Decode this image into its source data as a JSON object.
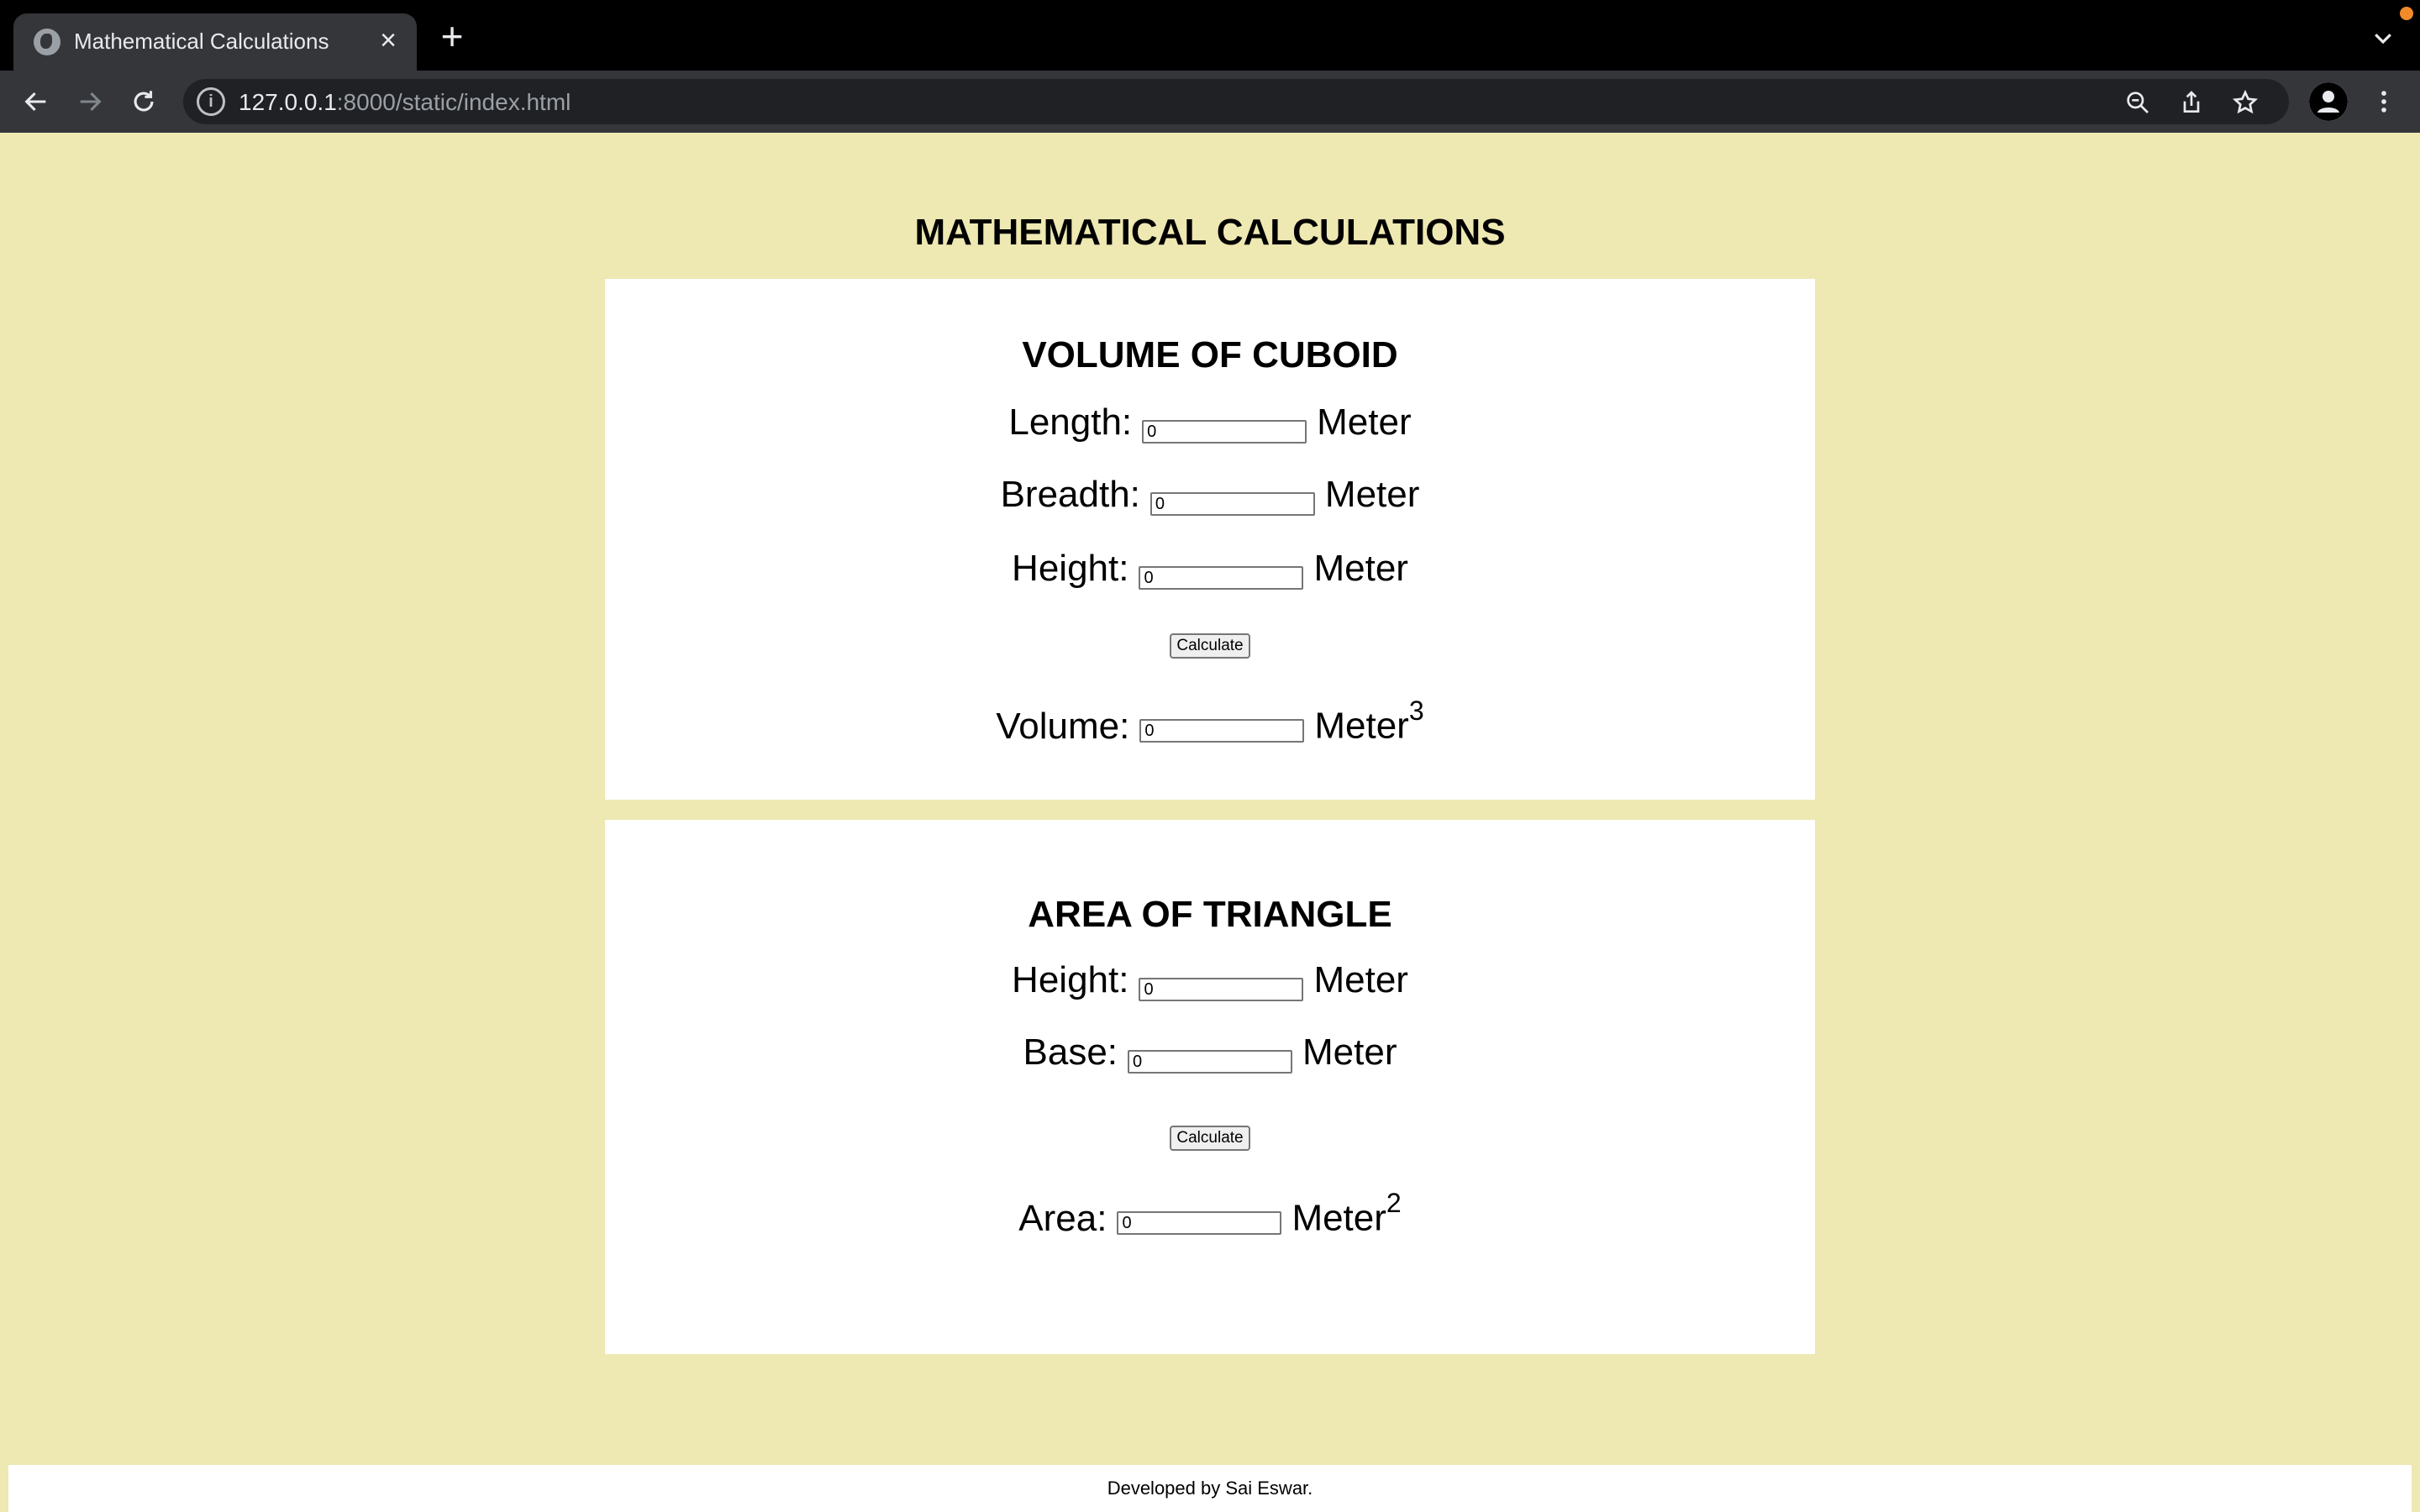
{
  "browser": {
    "tab_title": "Mathematical Calculations",
    "url_host": "127.0.0.1",
    "url_rest": ":8000/static/index.html"
  },
  "page": {
    "title": "MATHEMATICAL CALCULATIONS",
    "cuboid": {
      "title": "VOLUME OF CUBOID",
      "length_label": "Length:",
      "length_value": "0",
      "breadth_label": "Breadth:",
      "breadth_value": "0",
      "height_label": "Height:",
      "height_value": "0",
      "unit": "Meter",
      "button_label": "Calculate",
      "volume_label": "Volume:",
      "volume_value": "0",
      "volume_unit": "Meter",
      "volume_exponent": "3"
    },
    "triangle": {
      "title": "AREA OF TRIANGLE",
      "height_label": "Height:",
      "height_value": "0",
      "base_label": "Base:",
      "base_value": "0",
      "unit": "Meter",
      "button_label": "Calculate",
      "area_label": "Area:",
      "area_value": "0",
      "area_unit": "Meter",
      "area_exponent": "2"
    },
    "footer": "Developed by Sai Eswar."
  }
}
